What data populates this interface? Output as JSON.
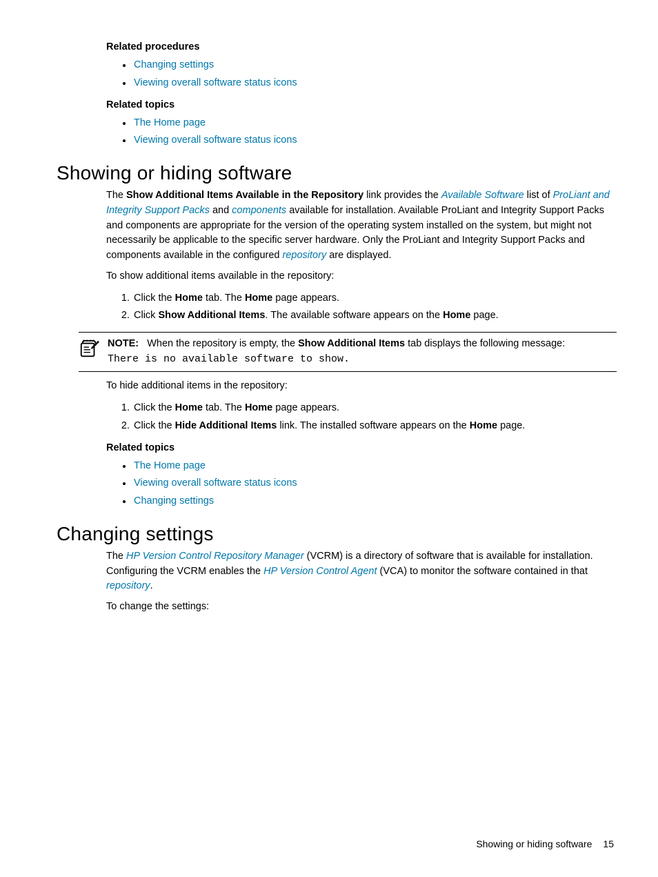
{
  "relatedProcedures": {
    "heading": "Related procedures",
    "items": [
      "Changing settings",
      "Viewing overall software status icons"
    ]
  },
  "relatedTopics1": {
    "heading": "Related topics",
    "items": [
      "The Home page",
      "Viewing overall software status icons"
    ]
  },
  "section1": {
    "title": "Showing or hiding software",
    "para1_pre": "The ",
    "para1_bold1": "Show Additional Items Available in the Repository",
    "para1_mid1": " link provides the ",
    "para1_link1": "Available Software",
    "para1_mid2": " list of ",
    "para1_link2": "ProLiant and Integrity Support Packs",
    "para1_mid3": " and ",
    "para1_link3": "components",
    "para1_mid4": " available for installation. Available ProLiant and Integrity Support Packs and components are appropriate for the version of the operating system installed on the system, but might not necessarily be applicable to the specific server hardware. Only the ProLiant and Integrity Support Packs and components available in the configured ",
    "para1_link4": "repository",
    "para1_end": " are displayed.",
    "para2": "To show additional items available in the repository:",
    "step1_pre": "Click the ",
    "step1_b1": "Home",
    "step1_mid": " tab. The ",
    "step1_b2": "Home",
    "step1_end": " page appears.",
    "step2_pre": "Click ",
    "step2_b1": "Show Additional Items",
    "step2_mid": ". The available software appears on the ",
    "step2_b2": "Home",
    "step2_end": " page.",
    "note_label": "NOTE:",
    "note_text_pre": "When the repository is empty, the ",
    "note_text_b": "Show Additional Items",
    "note_text_post": " tab displays the following message:",
    "note_mono": "There is no available software to show.",
    "para3": "To hide additional items in the repository:",
    "hstep1_pre": "Click the ",
    "hstep1_b1": "Home",
    "hstep1_mid": " tab. The ",
    "hstep1_b2": "Home",
    "hstep1_end": " page appears.",
    "hstep2_pre": "Click the ",
    "hstep2_b1": "Hide Additional Items",
    "hstep2_mid": " link. The installed software appears on the ",
    "hstep2_b2": "Home",
    "hstep2_end": " page."
  },
  "relatedTopics2": {
    "heading": "Related topics",
    "items": [
      "The Home page",
      "Viewing overall software status icons",
      "Changing settings"
    ]
  },
  "section2": {
    "title": "Changing settings",
    "para1_pre": "The ",
    "para1_link1": "HP Version Control Repository Manager",
    "para1_mid1": " (VCRM) is a directory of software that is available for installation. Configuring the VCRM enables the ",
    "para1_link2": "HP Version Control Agent",
    "para1_mid2": " (VCA) to monitor the software contained in that ",
    "para1_link3": "repository",
    "para1_end": ".",
    "para2": "To change the settings:"
  },
  "footer": {
    "text": "Showing or hiding software",
    "page": "15"
  }
}
